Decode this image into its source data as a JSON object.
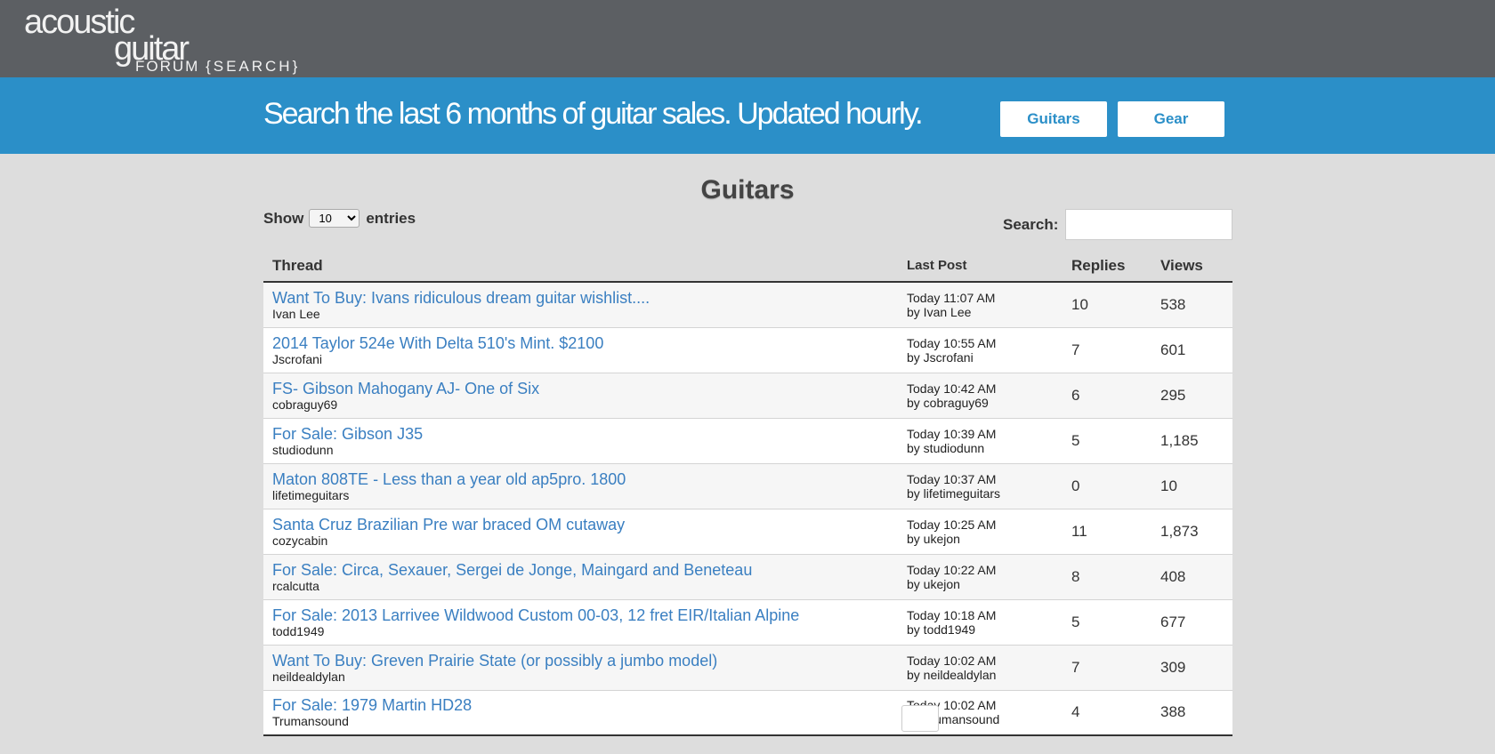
{
  "header": {
    "logo": {
      "line1": "acoustic",
      "line2": "guitar",
      "line3": "FORUM",
      "line3_suffix": "{SEARCH}"
    }
  },
  "banner": {
    "tagline": "Search the last 6 months of guitar sales. Updated hourly.",
    "buttons": {
      "guitars": "Guitars",
      "gear": "Gear"
    }
  },
  "main": {
    "title": "Guitars",
    "length": {
      "show": "Show",
      "value": "10",
      "entries": "entries"
    },
    "search": {
      "label": "Search:",
      "value": ""
    },
    "columns": {
      "thread": "Thread",
      "last_post": "Last Post",
      "replies": "Replies",
      "views": "Views"
    },
    "rows": [
      {
        "title": "Want To Buy: Ivans ridiculous dream guitar wishlist....",
        "author": "Ivan Lee",
        "last_time": "Today 11:07 AM",
        "last_by": "by Ivan Lee",
        "replies": "10",
        "views": "538"
      },
      {
        "title": "2014 Taylor 524e With Delta 510's Mint. $2100",
        "author": "Jscrofani",
        "last_time": "Today 10:55 AM",
        "last_by": "by Jscrofani",
        "replies": "7",
        "views": "601"
      },
      {
        "title": "FS- Gibson Mahogany AJ- One of Six",
        "author": "cobraguy69",
        "last_time": "Today 10:42 AM",
        "last_by": "by cobraguy69",
        "replies": "6",
        "views": "295"
      },
      {
        "title": "For Sale: Gibson J35",
        "author": "studiodunn",
        "last_time": "Today 10:39 AM",
        "last_by": "by studiodunn",
        "replies": "5",
        "views": "1,185"
      },
      {
        "title": "Maton 808TE - Less than a year old ap5pro. 1800",
        "author": "lifetimeguitars",
        "last_time": "Today 10:37 AM",
        "last_by": "by lifetimeguitars",
        "replies": "0",
        "views": "10"
      },
      {
        "title": "Santa Cruz Brazilian Pre war braced OM cutaway",
        "author": "cozycabin",
        "last_time": "Today 10:25 AM",
        "last_by": "by ukejon",
        "replies": "11",
        "views": "1,873"
      },
      {
        "title": "For Sale: Circa, Sexauer, Sergei de Jonge, Maingard and Beneteau",
        "author": "rcalcutta",
        "last_time": "Today 10:22 AM",
        "last_by": "by ukejon",
        "replies": "8",
        "views": "408"
      },
      {
        "title": "For Sale: 2013 Larrivee Wildwood Custom 00-03, 12 fret EIR/Italian Alpine",
        "author": "todd1949",
        "last_time": "Today 10:18 AM",
        "last_by": "by todd1949",
        "replies": "5",
        "views": "677"
      },
      {
        "title": "Want To Buy: Greven Prairie State (or possibly a jumbo model)",
        "author": "neildealdylan",
        "last_time": "Today 10:02 AM",
        "last_by": "by neildealdylan",
        "replies": "7",
        "views": "309"
      },
      {
        "title": "For Sale: 1979 Martin HD28",
        "author": "Trumansound",
        "last_time": "Today 10:02 AM",
        "last_by": "by Trumansound",
        "replies": "4",
        "views": "388"
      }
    ]
  },
  "colors": {
    "topbar": "#5c5f63",
    "banner": "#2b8fc8",
    "link": "#3a7fc1",
    "page_bg": "#dddddd"
  }
}
